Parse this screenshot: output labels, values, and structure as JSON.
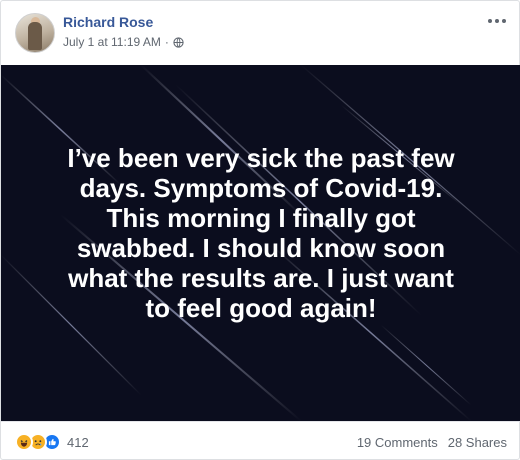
{
  "post": {
    "author": "Richard Rose",
    "timestamp": "July 1 at 11:19 AM",
    "separator": "·",
    "privacy_icon": "globe-icon",
    "menu_icon": "more-options-icon",
    "text_lines": [
      "I’ve been very sick the past few",
      "days. Symptoms of Covid-19.",
      "This morning I finally got",
      "swabbed. I should know soon",
      "what the results are. I just want",
      "to feel good again!"
    ],
    "background_color": "#0b0d1e",
    "text_color": "#ffffff"
  },
  "footer": {
    "reaction_icons": [
      "haha-reaction-icon",
      "sad-reaction-icon",
      "like-reaction-icon"
    ],
    "reaction_count": "412",
    "comments": "19 Comments",
    "shares": "28 Shares"
  },
  "colors": {
    "author_link": "#385898",
    "meta_text": "#606770",
    "like_blue": "#1877f2",
    "emoji_yellow": "#f7b125"
  }
}
